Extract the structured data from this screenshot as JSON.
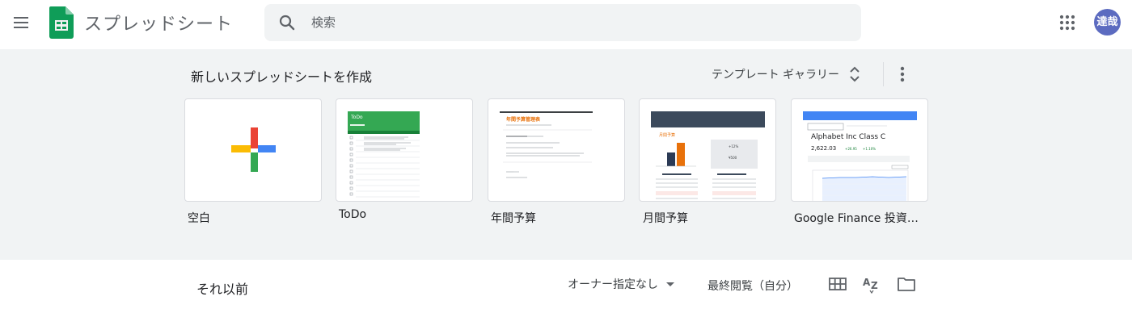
{
  "header": {
    "app_title": "スプレッドシート",
    "search_placeholder": "検索",
    "avatar_text": "達哉"
  },
  "gallery": {
    "title": "新しいスプレッドシートを作成",
    "gallery_button": "テンプレート ギャラリー",
    "templates": [
      {
        "label": "空白"
      },
      {
        "label": "ToDo",
        "thumb_title": "ToDo"
      },
      {
        "label": "年間予算",
        "thumb_title": "年間予算管理表"
      },
      {
        "label": "月間予算",
        "thumb_title": "月間予算",
        "thumb_stat1": "+12%",
        "thumb_stat2": "¥500"
      },
      {
        "label": "Google Finance 投資…",
        "thumb_title": "Alphabet Inc Class C",
        "thumb_price": "2,622.03",
        "thumb_change": "+26.95",
        "thumb_pct": "+1.10%"
      }
    ]
  },
  "recent": {
    "title": "それ以前",
    "owner_filter": "オーナー指定なし",
    "sort_label": "最終閲覧（自分）"
  },
  "colors": {
    "sheets_green": "#0f9d58",
    "plus_red": "#ea4335",
    "plus_blue": "#4285f4",
    "plus_green": "#34a853",
    "plus_yellow": "#fbbc04",
    "avatar_bg": "#5c6bc0"
  }
}
